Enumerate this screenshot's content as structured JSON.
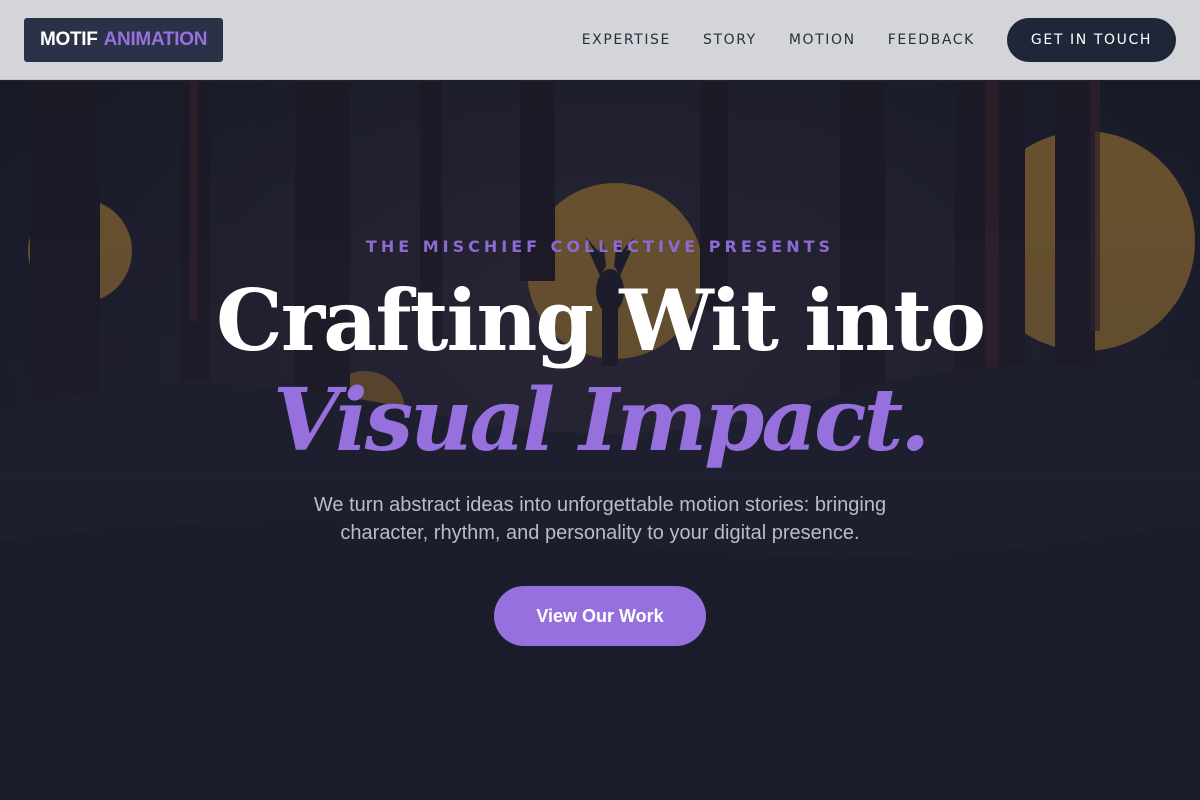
{
  "header": {
    "logo": {
      "word1": "MOTIF",
      "word2": "ANIMATION"
    },
    "nav": [
      "EXPERTISE",
      "STORY",
      "MOTION",
      "FEEDBACK"
    ],
    "cta_label": "GET IN TOUCH"
  },
  "hero": {
    "eyebrow": "THE MISCHIEF COLLECTIVE PRESENTS",
    "headline_line1": "Crafting Wit into",
    "headline_line2": "Visual Impact.",
    "subtitle_line1": "We turn abstract ideas into unforgettable motion stories: bringing",
    "subtitle_line2": "character, rhythm, and personality to your digital presence.",
    "button_label": "View Our Work"
  },
  "colors": {
    "accent": "#9670dc",
    "dark_navy": "#1f2638",
    "header_bg": "#d4d5d8",
    "hero_bg": "#1e2235"
  }
}
